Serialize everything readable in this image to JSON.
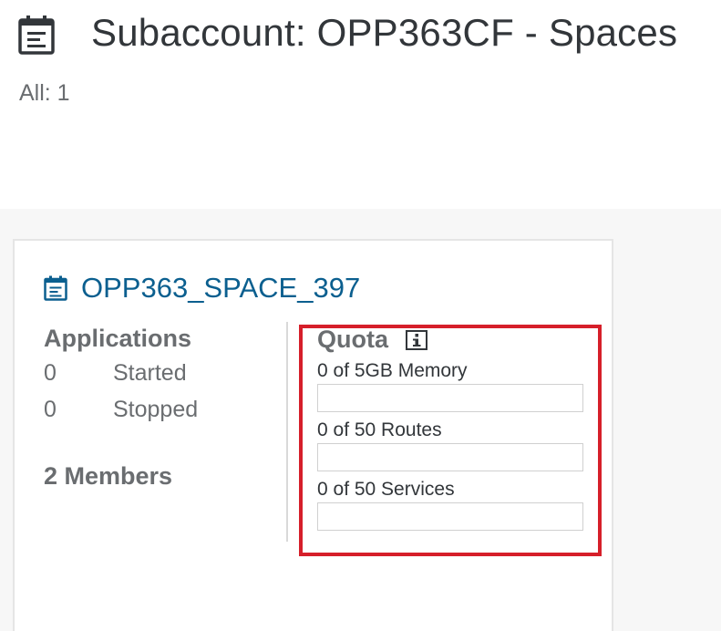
{
  "header": {
    "title": "Subaccount: OPP363CF - Spaces",
    "count_text": "All: 1",
    "icon": "calendar-list-icon"
  },
  "space": {
    "name": "OPP363_SPACE_397",
    "icon": "calendar-list-icon",
    "applications": {
      "title": "Applications",
      "stats": [
        {
          "value": "0",
          "label": "Started"
        },
        {
          "value": "0",
          "label": "Stopped"
        }
      ]
    },
    "members_text": "2 Members",
    "quota": {
      "title": "Quota",
      "info_icon": "info-icon",
      "items": [
        {
          "label": "0 of 5GB Memory",
          "fraction": 0
        },
        {
          "label": "0 of 50 Routes",
          "fraction": 0
        },
        {
          "label": "0 of 50 Services",
          "fraction": 0
        }
      ]
    }
  },
  "colors": {
    "link": "#0b5f8f",
    "highlight_border": "#d61f2a",
    "muted_text": "#6a6d70",
    "content_bg": "#f7f7f7"
  }
}
